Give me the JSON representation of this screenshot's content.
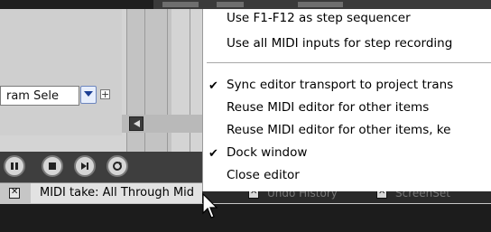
{
  "menu": {
    "items": [
      {
        "label": "Use F1-F12 as step sequencer",
        "checked": false
      },
      {
        "label": "Use all MIDI inputs for step recording",
        "checked": false
      },
      {
        "label": "Sync editor transport to project trans",
        "checked": true
      },
      {
        "label": "Reuse MIDI editor for other items",
        "checked": false
      },
      {
        "label": "Reuse MIDI editor for other items, ke",
        "checked": false
      },
      {
        "label": "Dock window",
        "checked": true
      },
      {
        "label": "Close editor",
        "checked": false
      }
    ],
    "check_glyph": "✔"
  },
  "editor": {
    "select_value": "ram Sele",
    "plus_glyph": "+"
  },
  "tabs": {
    "active_label": "MIDI take: All Through Mid",
    "second_label": "Undo History",
    "third_label": "ScreenSet",
    "close_glyph": "⊠"
  },
  "colors": {
    "menu_bg": "#ffffff",
    "transport_bg": "#3e3e3e",
    "tab_active_bg": "#e2e2e2"
  },
  "icons": [
    "pause-icon",
    "stop-icon",
    "next-icon",
    "repeat-icon",
    "chevron-down-icon",
    "arrow-left-icon",
    "cursor-pointer-icon"
  ]
}
